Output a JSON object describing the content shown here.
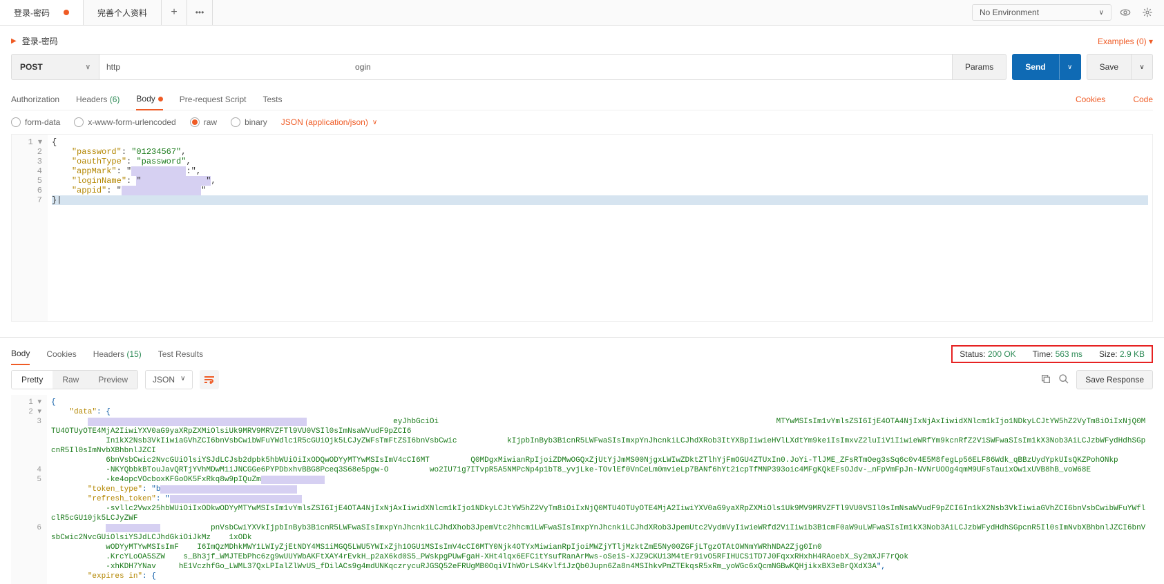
{
  "topbar": {
    "tabs": [
      "登录-密码",
      "完善个人资料"
    ],
    "env": "No Environment"
  },
  "breadcrumb": "登录-密码",
  "examples": "Examples (0)",
  "request": {
    "method": "POST",
    "url_prefix": "http",
    "url_suffix": "ogin",
    "params": "Params",
    "send": "Send",
    "save": "Save"
  },
  "subtabs": {
    "auth": "Authorization",
    "headers": "Headers",
    "headers_count": "(6)",
    "body": "Body",
    "prereq": "Pre-request Script",
    "tests": "Tests",
    "cookies": "Cookies",
    "code": "Code"
  },
  "body_opts": {
    "form": "form-data",
    "xform": "x-www-form-urlencoded",
    "raw": "raw",
    "binary": "binary",
    "ct": "JSON (application/json)"
  },
  "req_body": {
    "lines": [
      "1",
      "2",
      "3",
      "4",
      "5",
      "6",
      "7"
    ],
    "password_k": "\"password\"",
    "password_v": "\"01234567\"",
    "oauth_k": "\"oauthType\"",
    "oauth_v": "\"password\"",
    "appmark_k": "\"appMark\"",
    "login_k": "\"loginName\"",
    "appid_k": "\"appid\""
  },
  "resp_tabs": {
    "body": "Body",
    "cookies": "Cookies",
    "headers": "Headers",
    "headers_count": "(15)",
    "tests": "Test Results"
  },
  "status": {
    "status_l": "Status:",
    "status_v": "200 OK",
    "time_l": "Time:",
    "time_v": "563 ms",
    "size_l": "Size:",
    "size_v": "2.9 KB"
  },
  "resp_tool": {
    "pretty": "Pretty",
    "raw": "Raw",
    "preview": "Preview",
    "fmt": "JSON",
    "save": "Save Response"
  },
  "resp_body": {
    "lines": [
      "1",
      "2",
      "3",
      "",
      "",
      "",
      "4",
      "5",
      "",
      "",
      "",
      "6"
    ],
    "data_k": "\"data\"",
    "line3a": "                   eyJhbGciOi                                                                          MTYwMSIsIm1vYmlsZSI6IjE4OTA4NjIxNjAxIiwidXNlcm1kIjo1NDkyLCJtYW5hZ2VyTm8iOiIxNjQ0MTU4OTUyOTE4MjA2IiwiYXV0aG9yaXRpZXMiOlsiUk9MRV9MRVZFTl9VU0VSIl0sImNsaWVudF9pZCI6",
    "line3b": "In1kX2Nsb3VkIiwiaGVhZCI6bnVsbCwibWFuYWdlc1R5cGUiOjk5LCJyZWFsTmFtZSI6bnVsbCwic           kIjpbInByb3B1cnR5LWFwaSIsImxpYnJhcnkiLCJhdXRob3ItYXBpIiwieHVlLXdtYm9keiIsImxvZ2luIiV1IiwieWRfYm9kcnRfZ2V1SWFwaSIsIm1kX3Nob3AiLCJzbWFydHdhSGpcnR5Il0sImNvbXBhbnlJZCI",
    "line3c": "6bnVsbCwic2NvcGUiOlsiYSJdLCJsb2dpbk5hbWUiOiIxODQwODYyMTYwMSIsImV4cCI6MT         Q0MDgxMiwianRpIjoiZDMwOGQxZjUtYjJmMS00NjgxLWIwZDktZTlhYjFmOGU4ZTUxIn0.JoYi-TlJME_ZFsRTmOeg3sSq6c0v4E5M8fegLp56ELF86Wdk_qBBzUydYpkUIsQKZPohONkp",
    "line3d": "-NKYQbbkBTouJavQRTjYVhMDwM1iJNCGGe6PYPDbxhvBBG8Pceq3S68e5pgw-O         wo2IU71g7ITvpR5A5NMPcNp4p1bT8_yvjLke-TOvlEf0VnCeLm0mvieLp7BANf6hYt2icpTfMNP393oic4MFgKQkEFsOJdv-_nFpVmFpJn-NVNrUOOg4qmM9UFsTauixOw1xUVB8hB_voW68E",
    "line3e": "-ke4opcVOcboxKFGoOK5FxRkq8w9pIQuZm",
    "tt_k": "\"token_type\"",
    "rt_k": "\"refresh_token\"",
    "line5a": "-svllc2Vwx25hbWUiOiIxODkwODYyMTYwMSIsIm1vYmlsZSI6IjE4OTA4NjIxNjAxIiwidXNlcm1kIjo1NDkyLCJtYW5hZ2VyTm8iOiIxNjQ0MTU4OTUyOTE4MjA2IiwiYXV0aG9yaXRpZXMiOls1Uk9MV9MRVZFTl9VU0VSIl0sImNsaWVudF9pZCI6In1kX2Nsb3VkIiwiaGVhZCI6bnVsbCwibWFuYWflclR5cGU10jk5LCJyZWF",
    "line5b": "           pnVsbCwiYXVkIjpbInByb3B1cnR5LWFwaSIsImxpYnJhcnkiLCJhdXhob3JpemVtc2hhcm1LWFwaSIsImxpYnJhcnkiLCJhdXRob3JpemUtc2VydmVyIiwieWRfd2ViIiwib3B1cmF0aW9uLWFwaSIsIm1kX3Nob3AiLCJzbWFydHdhSGpcnR5Il0sImNvbXBhbnlJZCI6bnVsbCwic2NvcGUiOlsiYSJdLCJhdGkiOiJkMz    1xODk",
    "line5c": "wODYyMTYwMSIsImF    I6ImQzMDhkMWY1LWIyZjEtNDY4MS1iMGQ5LWU5YWIxZjh1OGU1MSIsImV4cCI6MTY0Njk4OTYxMiwianRpIjoiMWZjYTljMzktZmE5Ny00ZGFjLTgzOTAtOWNmYWRhNDA2Zjg0In0",
    "line5d": ".KrcYLoOA5SZW    s_Bh3jf_WMJTEbPhc6zg9wUUYWbAKFtXAY4rEvkH_p2aX6kd0S5_PWskpgPUwFgaH-XHt4lqx6EFCitYsufRanArMws-oSeiS-XJZ9CKU13M4tEr9ivO5RFIHUCS1TD7J0FqxxRHxhH4RAoebX_Sy2mXJF7rQok",
    "line5e": "-xhKDH7YNav     hE1VczhfGo_LWML37QxLPIalZlWvUS_fDilACs9g4mdUNKqczrycuRJGSQ52eFRUgMB0OqiVIhWOrLS4Kvlf1JzQb0Jupn6Za8n4MSIhkvPmZTEkqsR5xRm_yoWGc6xQcmNGBwKQHjikxBX3eBrQXdX3A",
    "exp_k": "\"expires in\""
  }
}
